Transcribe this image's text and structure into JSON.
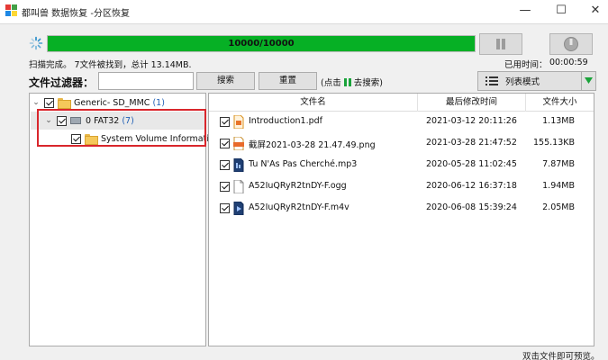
{
  "window": {
    "title": "都叫兽 数据恢复 -分区恢复",
    "minimize": "—",
    "maximize": "☐",
    "close": "✕"
  },
  "progress": {
    "text": "10000/10000",
    "fraction": 1.0,
    "color": "#06b025"
  },
  "status": {
    "scan_summary": "扫描完成。 7文件被找到，总计 13.14MB.",
    "time_label": "已用时间：",
    "time_value": "00:00:59"
  },
  "filter": {
    "label": "文件过滤器：",
    "input_value": "",
    "search_button": "搜索",
    "reset_button": "重置",
    "hint_prefix": "(点击",
    "hint_suffix": "去搜索)"
  },
  "view_mode": {
    "label": "列表模式"
  },
  "tree": {
    "items": [
      {
        "name": "Generic- SD_MMC",
        "count": "(1)",
        "icon": "folder-icon"
      },
      {
        "name": "0 FAT32",
        "count": "(7)",
        "icon": "drive-icon"
      },
      {
        "name": "System Volume Information",
        "count": "",
        "icon": "folder-icon"
      }
    ]
  },
  "list": {
    "headers": {
      "name": "文件名",
      "modified": "最后修改时间",
      "size": "文件大小"
    },
    "rows": [
      {
        "name": "Introduction1.pdf",
        "modified": "2021-03-12 20:11:26",
        "size": "1.13MB",
        "icon": "pdf-file-icon"
      },
      {
        "name": "截屏2021-03-28 21.47.49.png",
        "modified": "2021-03-28 21:47:52",
        "size": "155.13KB",
        "icon": "png-file-icon"
      },
      {
        "name": "Tu N'As Pas Cherché.mp3",
        "modified": "2020-05-28 11:02:45",
        "size": "7.87MB",
        "icon": "audio-file-icon"
      },
      {
        "name": "A52IuQRyR2tnDY-F.ogg",
        "modified": "2020-06-12 16:37:18",
        "size": "1.94MB",
        "icon": "generic-file-icon"
      },
      {
        "name": "A52IuQRyR2tnDY-F.m4v",
        "modified": "2020-06-08 15:39:24",
        "size": "2.05MB",
        "icon": "video-file-icon"
      }
    ]
  },
  "footer": {
    "hint": "双击文件即可预览。"
  }
}
